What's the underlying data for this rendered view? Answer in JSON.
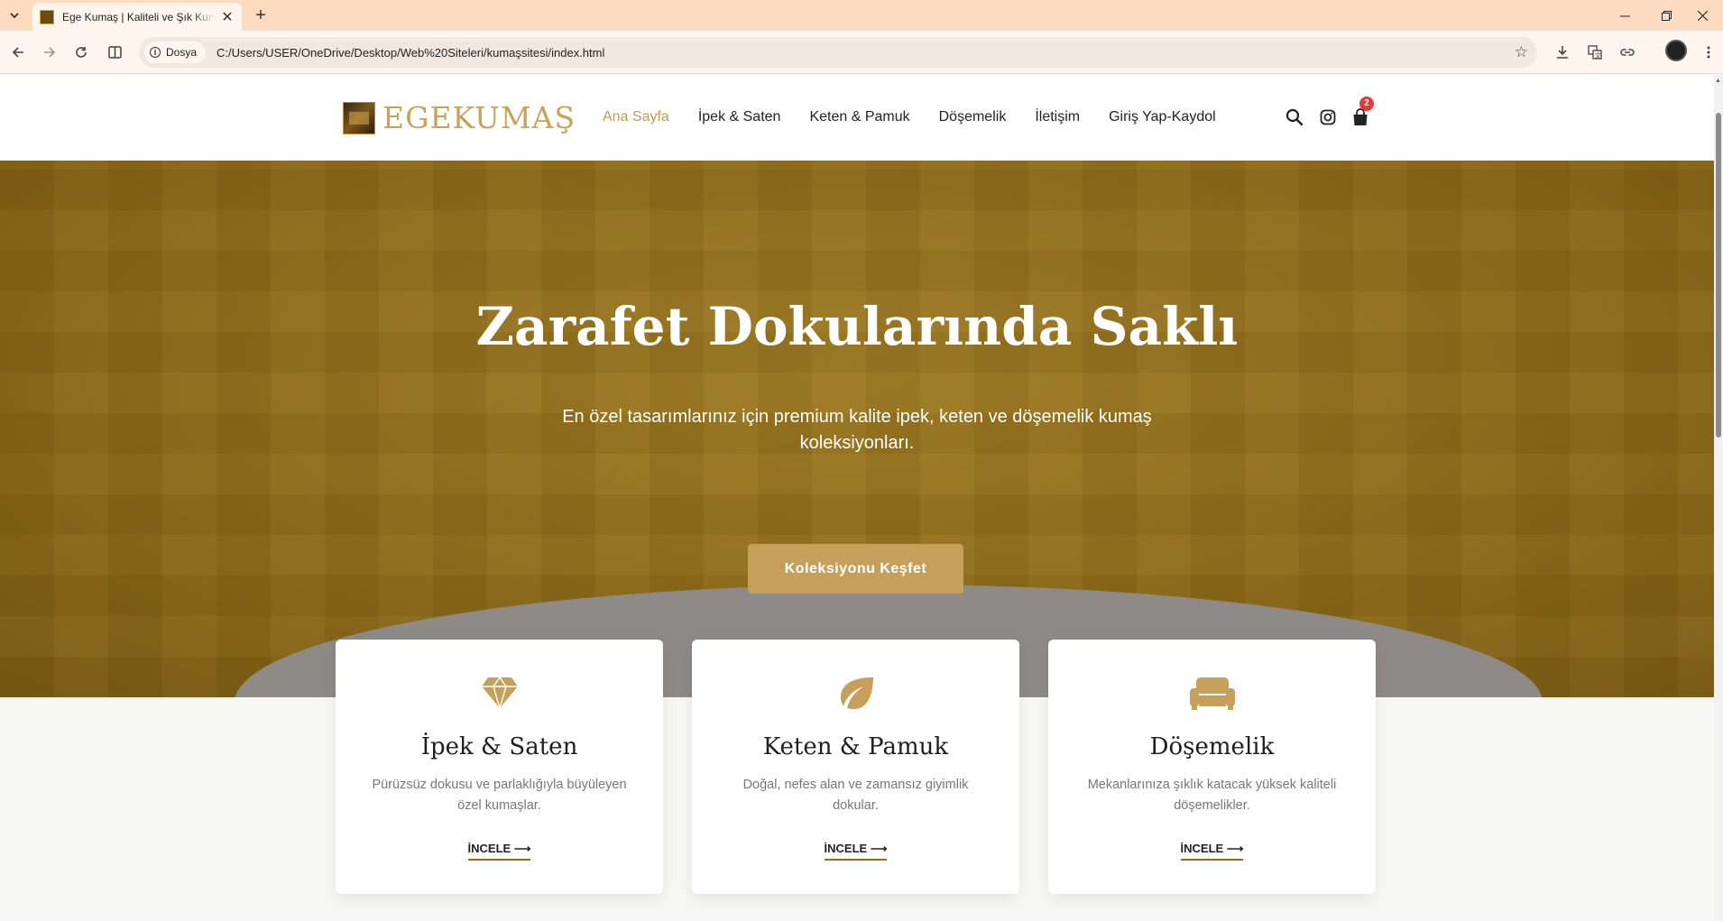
{
  "browser": {
    "tab_title": "Ege Kumaş | Kaliteli ve Şık Kumaşlar",
    "site_chip": "Dosya",
    "url": "C:/Users/USER/OneDrive/Desktop/Web%20Siteleri/kumaşsitesi/index.html",
    "colors": {
      "tabstrip": "#fddbc0",
      "toolbar": "#fef6ee"
    }
  },
  "site": {
    "logo_text": "EGEKUMAŞ",
    "nav": [
      "Ana Sayfa",
      "İpek & Saten",
      "Keten & Pamuk",
      "Döşemelik",
      "İletişim",
      "Giriş Yap-Kaydol"
    ],
    "active_nav": "Ana Sayfa",
    "cart_count": "2",
    "accent_color": "#c49a4d"
  },
  "hero": {
    "title": "Zarafet Dokularında Saklı",
    "subtitle": "En özel tasarımlarınız için premium kalite ipek, keten ve döşemelik kumaş koleksiyonları.",
    "cta_label": "Koleksiyonu Keşfet"
  },
  "cards": [
    {
      "icon": "diamond-icon",
      "title": "İpek & Saten",
      "text": "Pürüzsüz dokusu ve parlaklığıyla büyüleyen özel kumaşlar.",
      "link": "İNCELE ⟶"
    },
    {
      "icon": "leaf-icon",
      "title": "Keten & Pamuk",
      "text": "Doğal, nefes alan ve zamansız giyimlik dokular.",
      "link": "İNCELE ⟶"
    },
    {
      "icon": "couch-icon",
      "title": "Döşemelik",
      "text": "Mekanlarınıza şıklık katacak yüksek kaliteli döşemelikler.",
      "link": "İNCELE ⟶"
    }
  ]
}
